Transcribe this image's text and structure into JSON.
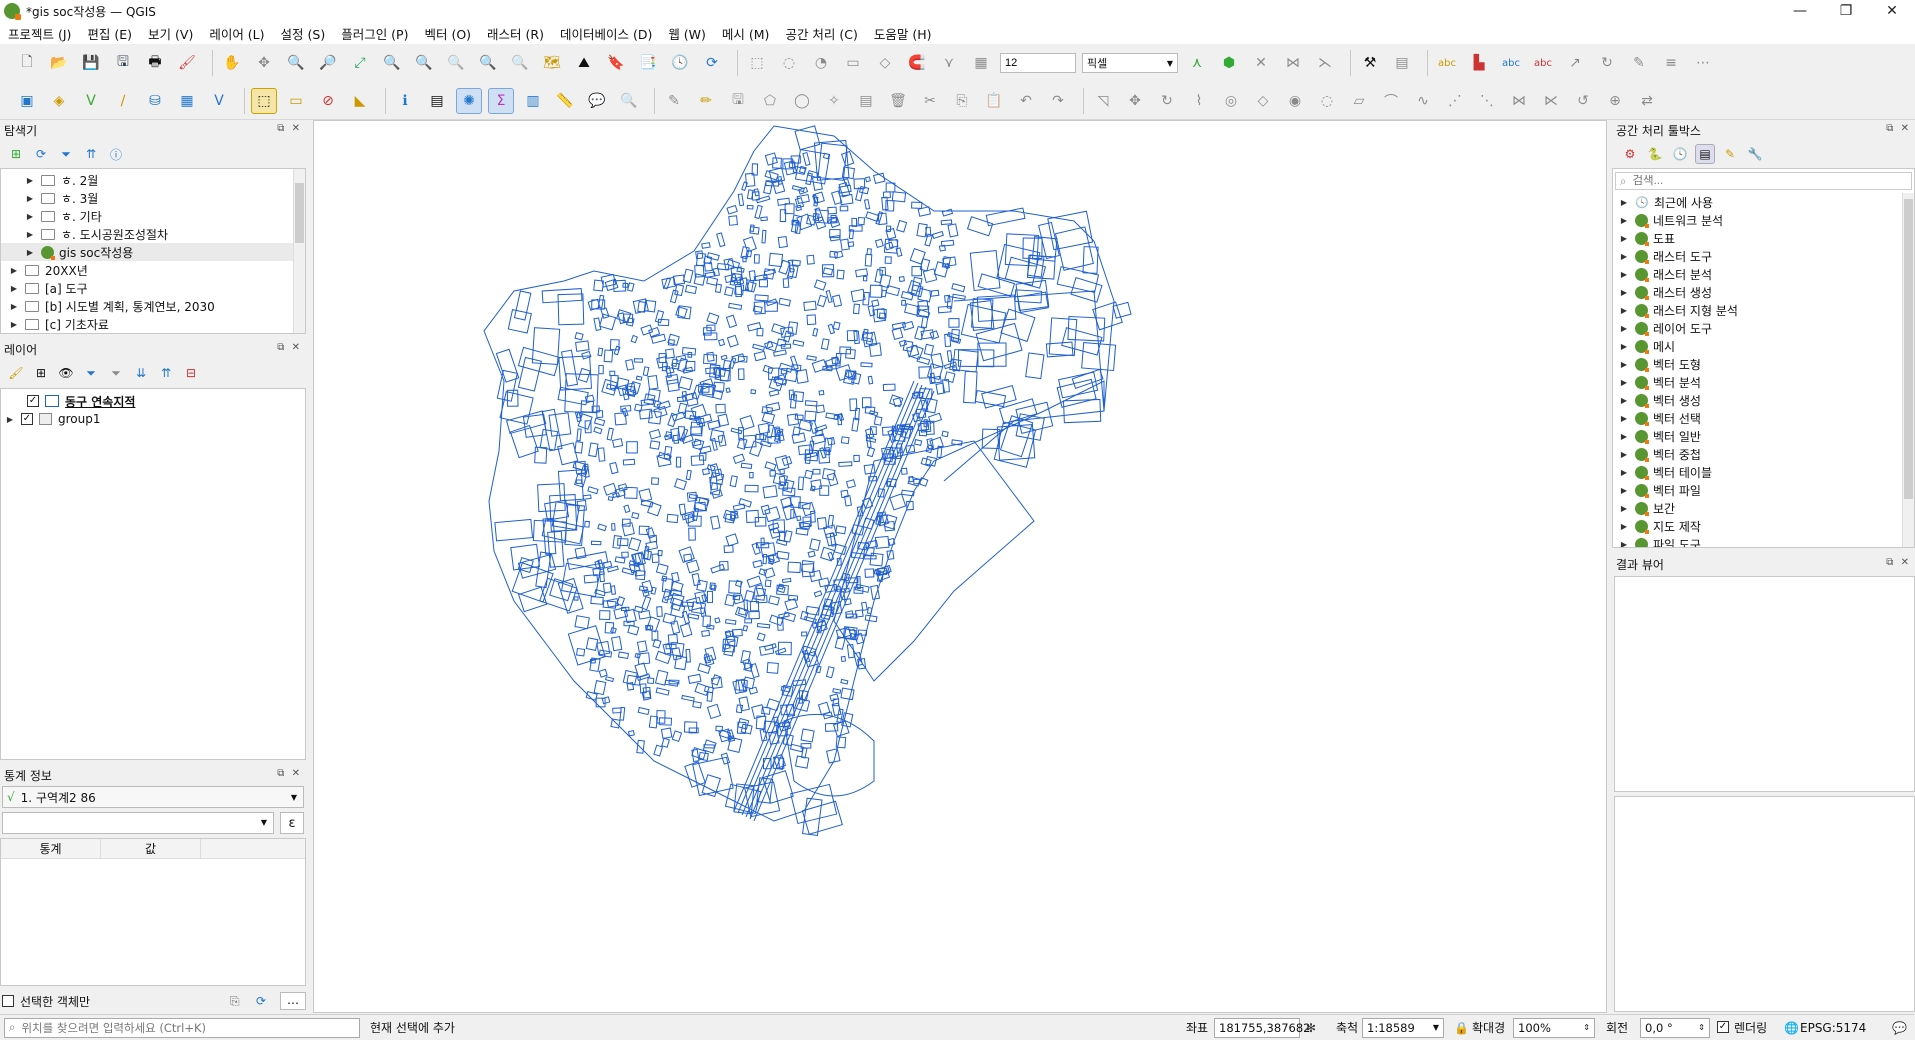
{
  "window": {
    "title": "*gis soc작성용 — QGIS",
    "controls": [
      "—",
      "❐",
      "✕"
    ]
  },
  "menu": [
    "프로젝트 (J)",
    "편집 (E)",
    "보기 (V)",
    "레이어 (L)",
    "설정 (S)",
    "플러그인 (P)",
    "벡터 (O)",
    "래스터 (R)",
    "데이터베이스 (D)",
    "웹 (W)",
    "메시 (M)",
    "공간 처리 (C)",
    "도움말 (H)"
  ],
  "toolbar": {
    "snap_tolerance": "12",
    "snap_unit": "픽셀"
  },
  "browser": {
    "title": "탐색기",
    "items": [
      {
        "label": "ㅎ. 2월",
        "type": "folder",
        "indent": 1
      },
      {
        "label": "ㅎ. 3월",
        "type": "folder",
        "indent": 1
      },
      {
        "label": "ㅎ. 기타",
        "type": "folder",
        "indent": 1
      },
      {
        "label": "ㅎ. 도시공원조성절차",
        "type": "folder",
        "indent": 1
      },
      {
        "label": "gis soc작성용",
        "type": "qgis",
        "indent": 1
      },
      {
        "label": "20XX년",
        "type": "folder",
        "indent": 0
      },
      {
        "label": "[a] 도구",
        "type": "folder",
        "indent": 0
      },
      {
        "label": "[b] 시도별 계획, 통계연보, 2030",
        "type": "folder",
        "indent": 0
      },
      {
        "label": "[c] 기초자료",
        "type": "folder",
        "indent": 0
      }
    ]
  },
  "layers": {
    "title": "레이어",
    "items": [
      {
        "label": "동구 연속지적",
        "checked": true
      },
      {
        "label": "group1",
        "checked": true
      }
    ]
  },
  "stats": {
    "title": "통계 정보",
    "layer_select": "1. 구역계2 86",
    "col_stat": "통계",
    "col_value": "값",
    "selected_only": "선택한 객체만"
  },
  "toolbox": {
    "title": "공간 처리 툴박스",
    "search_placeholder": "검색...",
    "items": [
      "최근에 사용",
      "네트워크 분석",
      "도표",
      "래스터 도구",
      "래스터 분석",
      "래스터 생성",
      "래스터 지형 분석",
      "레이어 도구",
      "메시",
      "벡터 도형",
      "벡터 분석",
      "벡터 생성",
      "벡터 선택",
      "벡터 일반",
      "벡터 중첩",
      "벡터 테이블",
      "벡터 파일",
      "보간",
      "지도 제작",
      "파일 도구"
    ]
  },
  "results": {
    "title": "결과 뷰어"
  },
  "status": {
    "locator_placeholder": "위치를 찾으려면 입력하세요 (Ctrl+K)",
    "message": "현재 선택에 추가",
    "coord_label": "좌표",
    "coord_value": "181755,387682",
    "scale_label": "축척",
    "scale_value": "1:18589",
    "magnifier_label": "확대경",
    "magnifier_value": "100%",
    "rotation_label": "회전",
    "rotation_value": "0,0 °",
    "render_label": "렌더링",
    "crs": "EPSG:5174"
  },
  "colors": {
    "map_stroke": "#1f5fd0",
    "qgis_green": "#589632",
    "qgis_orange": "#ee7913"
  }
}
